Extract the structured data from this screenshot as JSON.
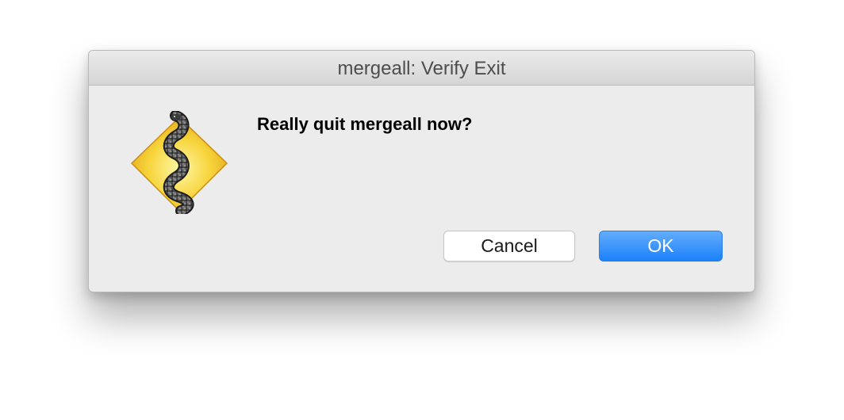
{
  "window": {
    "title": "mergeall: Verify Exit"
  },
  "dialog": {
    "message": "Really quit mergeall now?",
    "icon": "python-snake-diamond-icon"
  },
  "buttons": {
    "cancel_label": "Cancel",
    "ok_label": "OK"
  },
  "colors": {
    "ok_button": "#1c81f9",
    "icon_diamond": "#f3c32a",
    "window_background": "#ececec"
  }
}
